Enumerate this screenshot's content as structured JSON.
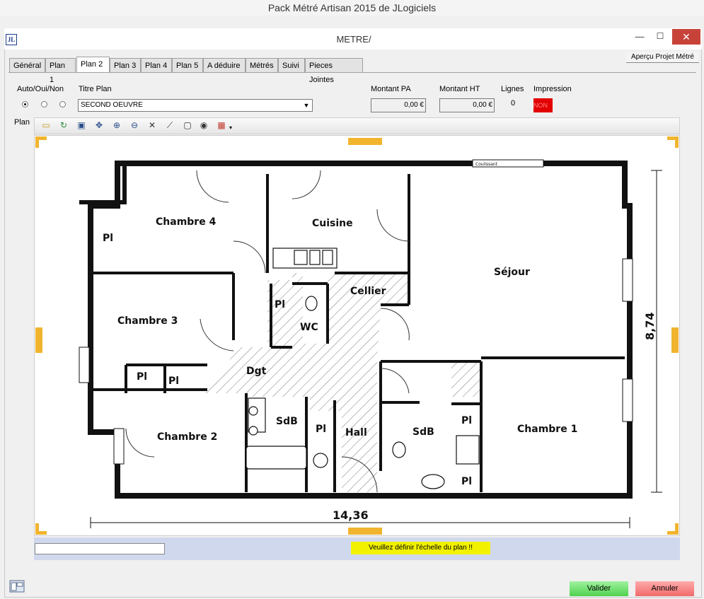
{
  "app": {
    "title": "Pack Métré Artisan 2015 de JLogiciels"
  },
  "window": {
    "title": "METRE/",
    "icon_text": "JL",
    "minimize": "—",
    "maximize": "☐",
    "close": "✕"
  },
  "apercu_label": "Aperçu Projet Métré",
  "tabs": [
    {
      "label": "Général",
      "active": false
    },
    {
      "label": "Plan 1",
      "active": false
    },
    {
      "label": "Plan 2",
      "active": true
    },
    {
      "label": "Plan 3",
      "active": false
    },
    {
      "label": "Plan 4",
      "active": false
    },
    {
      "label": "Plan 5",
      "active": false
    },
    {
      "label": "A déduire",
      "active": false
    },
    {
      "label": "Métrés",
      "active": false
    },
    {
      "label": "Suivi",
      "active": false
    },
    {
      "label": "Pieces Jointes",
      "active": false
    }
  ],
  "form": {
    "auto_label": "Auto/Oui/Non",
    "auto_selected": 0,
    "titre_label": "Titre Plan",
    "titre_value": "SECOND OEUVRE",
    "montant_pa_label": "Montant PA",
    "montant_pa_value": "0,00 €",
    "montant_ht_label": "Montant HT",
    "montant_ht_value": "0,00 €",
    "lignes_label": "Lignes",
    "lignes_value": "0",
    "impression_label": "Impression",
    "impression_value": "NON",
    "impression_color": "#e20000"
  },
  "plan_label": "Plan",
  "toolbar_icons": [
    "folder-open-icon",
    "refresh-icon",
    "fit-icon",
    "pan-icon",
    "zoom-in-icon",
    "zoom-out-icon",
    "zoom-extents-icon",
    "measure-icon",
    "rectangle-icon",
    "eye-icon",
    "palette-icon"
  ],
  "floorplan": {
    "rooms": [
      {
        "name": "chambre-4",
        "label": "Chambre 4"
      },
      {
        "name": "cuisine",
        "label": "Cuisine"
      },
      {
        "name": "sejour",
        "label": "Séjour"
      },
      {
        "name": "cellier",
        "label": "Cellier"
      },
      {
        "name": "chambre-3",
        "label": "Chambre 3"
      },
      {
        "name": "wc",
        "label": "WC"
      },
      {
        "name": "dgt",
        "label": "Dgt"
      },
      {
        "name": "chambre-2",
        "label": "Chambre 2"
      },
      {
        "name": "sdb-left",
        "label": "SdB"
      },
      {
        "name": "hall",
        "label": "Hall"
      },
      {
        "name": "sdb-right",
        "label": "SdB"
      },
      {
        "name": "chambre-1",
        "label": "Chambre 1"
      }
    ],
    "pl_label": "Pl",
    "coulissant": "Coulissant",
    "dim_width": "14,36",
    "dim_height": "8,74"
  },
  "status": {
    "warning": "Veuillez définir l'échelle du plan !!",
    "warning_color": "#f2f200"
  },
  "buttons": {
    "valider": "Valider",
    "annuler": "Annuler"
  }
}
